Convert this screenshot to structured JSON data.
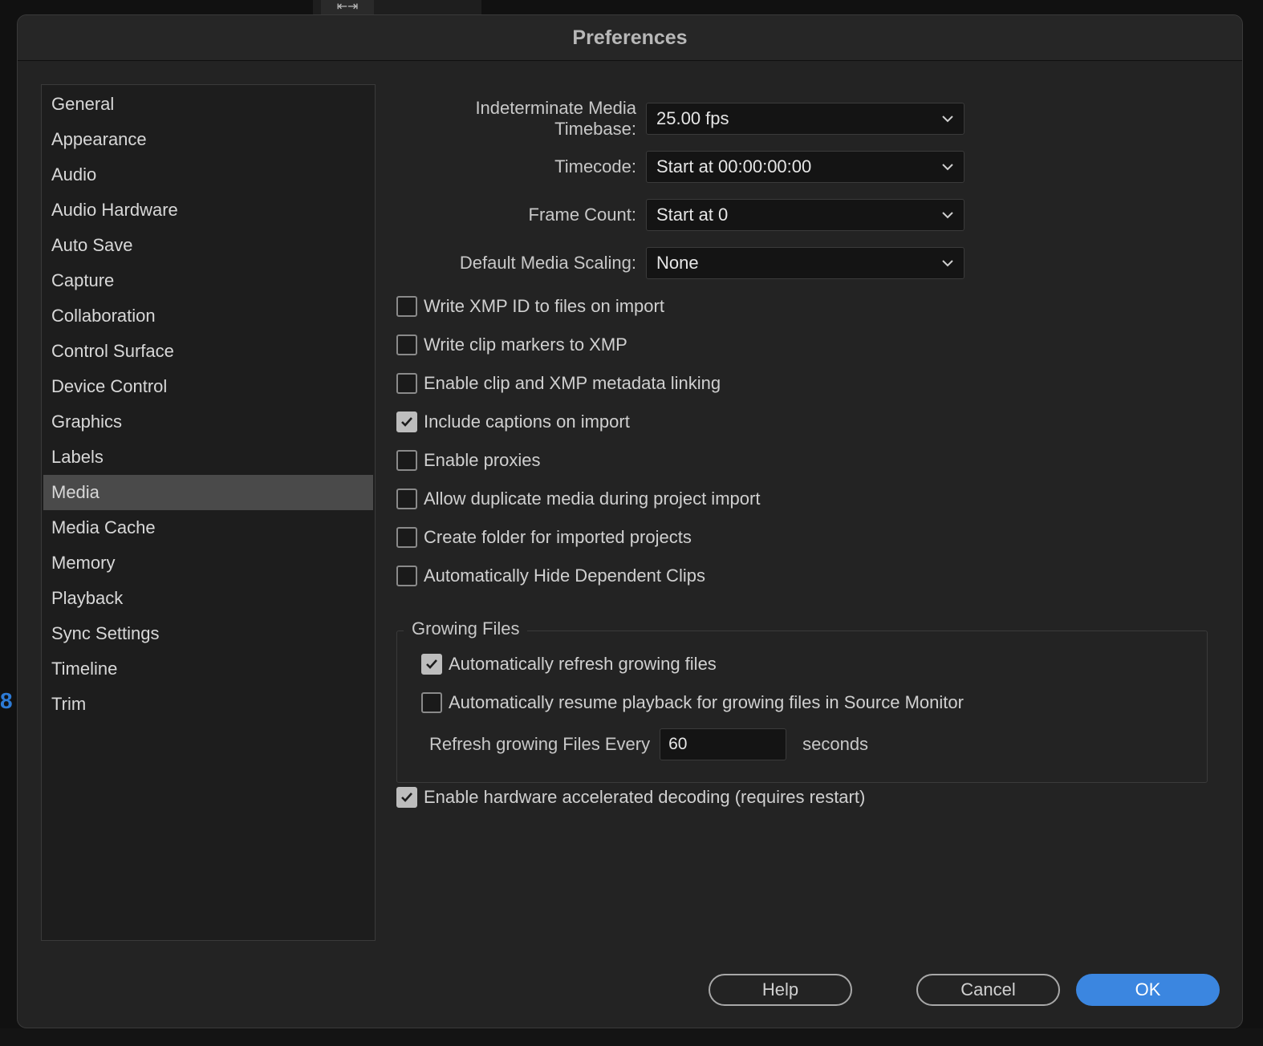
{
  "dialog": {
    "title": "Preferences"
  },
  "sidebar": {
    "items": [
      {
        "label": "General"
      },
      {
        "label": "Appearance"
      },
      {
        "label": "Audio"
      },
      {
        "label": "Audio Hardware"
      },
      {
        "label": "Auto Save"
      },
      {
        "label": "Capture"
      },
      {
        "label": "Collaboration"
      },
      {
        "label": "Control Surface"
      },
      {
        "label": "Device Control"
      },
      {
        "label": "Graphics"
      },
      {
        "label": "Labels"
      },
      {
        "label": "Media",
        "selected": true
      },
      {
        "label": "Media Cache"
      },
      {
        "label": "Memory"
      },
      {
        "label": "Playback"
      },
      {
        "label": "Sync Settings"
      },
      {
        "label": "Timeline"
      },
      {
        "label": "Trim"
      }
    ]
  },
  "media": {
    "timebase": {
      "label": "Indeterminate Media Timebase:",
      "value": "25.00 fps"
    },
    "timecode": {
      "label": "Timecode:",
      "value": "Start at 00:00:00:00"
    },
    "frame_count": {
      "label": "Frame Count:",
      "value": "Start at 0"
    },
    "scaling": {
      "label": "Default Media Scaling:",
      "value": "None"
    },
    "options": [
      {
        "label": "Write XMP ID to files on import",
        "checked": false
      },
      {
        "label": "Write clip markers to XMP",
        "checked": false
      },
      {
        "label": "Enable clip and XMP metadata linking",
        "checked": false
      },
      {
        "label": "Include captions on import",
        "checked": true
      },
      {
        "label": "Enable proxies",
        "checked": false
      },
      {
        "label": "Allow duplicate media during project import",
        "checked": false
      },
      {
        "label": "Create folder for imported projects",
        "checked": false
      },
      {
        "label": "Automatically Hide Dependent Clips",
        "checked": false
      }
    ],
    "growing_files": {
      "legend": "Growing Files",
      "auto_refresh": {
        "label": "Automatically refresh growing files",
        "checked": true
      },
      "auto_resume": {
        "label": "Automatically resume playback for growing files in Source Monitor",
        "checked": false
      },
      "refresh_label": "Refresh growing Files Every",
      "refresh_value": "60",
      "refresh_unit": "seconds"
    },
    "hw_decoding": {
      "label": "Enable hardware accelerated decoding (requires restart)",
      "checked": true
    }
  },
  "buttons": {
    "help": "Help",
    "cancel": "Cancel",
    "ok": "OK"
  },
  "colors": {
    "accent": "#3b86e0",
    "background": "#232323",
    "selected_item": "#4a4a4a"
  },
  "background_app": {
    "number_label": "8"
  }
}
